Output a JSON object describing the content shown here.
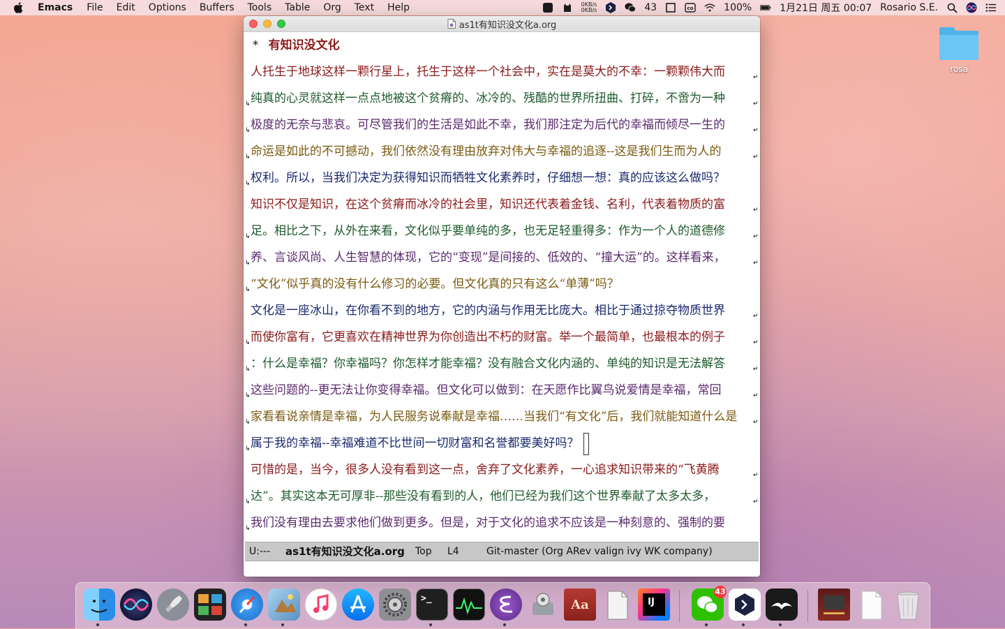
{
  "menubar": {
    "app_name": "Emacs",
    "menus": [
      "File",
      "Edit",
      "Options",
      "Buffers",
      "Tools",
      "Table",
      "Org",
      "Text",
      "Help"
    ],
    "net_up": "0KB/s",
    "net_down": "0KB/s",
    "wechat_count": "43",
    "battery": "100%",
    "datetime": "1月21日 周五 00:07",
    "user": "Rosario S.E."
  },
  "desktop": {
    "folder_label": "rosa"
  },
  "window": {
    "title": "as1t有知识没文化a.org",
    "heading_star": "*",
    "heading": "有知识没文化",
    "lines": [
      "人托生于地球这样一颗行星上，托生于这样一个社会中，实在是莫大的不幸：一颗颗伟大而",
      "纯真的心灵就这样一点点地被这个贫瘠的、冰冷的、残酷的世界所扭曲、打碎，不啻为一种",
      "极度的无奈与悲哀。可尽管我们的生活是如此不幸，我们那注定为后代的幸福而倾尽一生的",
      "命运是如此的不可撼动，我们依然没有理由放弃对伟大与幸福的追逐--这是我们生而为人的",
      "权利。所以，当我们决定为获得知识而牺牲文化素养时，仔细想一想：真的应该这么做吗？",
      "知识不仅是知识，在这个贫瘠而冰冷的社会里，知识还代表着金钱、名利，代表着物质的富",
      "足。相比之下，从外在来看，文化似乎要单纯的多，也无足轻重得多：作为一个人的道德修",
      "养、言谈风尚、人生智慧的体现，它的“变现”是间接的、低效的、“撞大运”的。这样看来，",
      "“文化”似乎真的没有什么修习的必要。但文化真的只有这么“单薄”吗？",
      "文化是一座冰山，在你看不到的地方，它的内涵与作用无比庞大。相比于通过掠夺物质世界",
      "而使你富有，它更喜欢在精神世界为你创造出不朽的财富。举一个最简单，也最根本的例子",
      "：什么是幸福？你幸福吗？你怎样才能幸福？没有融合文化内涵的、单纯的知识是无法解答",
      "这些问题的--更无法让你变得幸福。但文化可以做到：在天愿作比翼鸟说爱情是幸福，常回",
      "家看看说亲情是幸福，为人民服务说奉献是幸福……当我们“有文化”后，我们就能知道什么是",
      "属于我的幸福--幸福难道不比世间一切财富和名誉都要美好吗？",
      "可惜的是，当今，很多人没有看到这一点，舍弃了文化素养，一心追求知识带来的“飞黄腾",
      "达”。其实这本无可厚非--那些没有看到的人，他们已经为我们这个世界奉献了太多太多，",
      "我们没有理由去要求他们做到更多。但是，对于文化的追求不应该是一种刻意的、强制的要"
    ]
  },
  "modeline": {
    "status": "U:---",
    "buffer_name": "as1t有知识没文化a.org",
    "position": "Top",
    "line": "L4",
    "modes": "Git-master  (Org ARev valign ivy WK company)"
  },
  "dock": {
    "items": [
      {
        "name": "Finder"
      },
      {
        "name": "Siri"
      },
      {
        "name": "Launchpad"
      },
      {
        "name": "Photo Booth"
      },
      {
        "name": "Safari"
      },
      {
        "name": "Preview"
      },
      {
        "name": "Music"
      },
      {
        "name": "App Store"
      },
      {
        "name": "System Preferences"
      },
      {
        "name": "Terminal"
      },
      {
        "name": "Activity Monitor"
      },
      {
        "name": "Emacs"
      },
      {
        "name": "Disk Utility"
      },
      {
        "name": "Dictionary"
      },
      {
        "name": "TextEdit"
      },
      {
        "name": "IntelliJ IDEA"
      },
      {
        "name": "WeChat"
      },
      {
        "name": "Terminal Tool"
      },
      {
        "name": "Mail Bird"
      },
      {
        "name": "Book"
      },
      {
        "name": "Document"
      },
      {
        "name": "Trash"
      }
    ],
    "wechat_badge": "43",
    "idea_label": "IJ",
    "dictionary_label": "Aa"
  }
}
